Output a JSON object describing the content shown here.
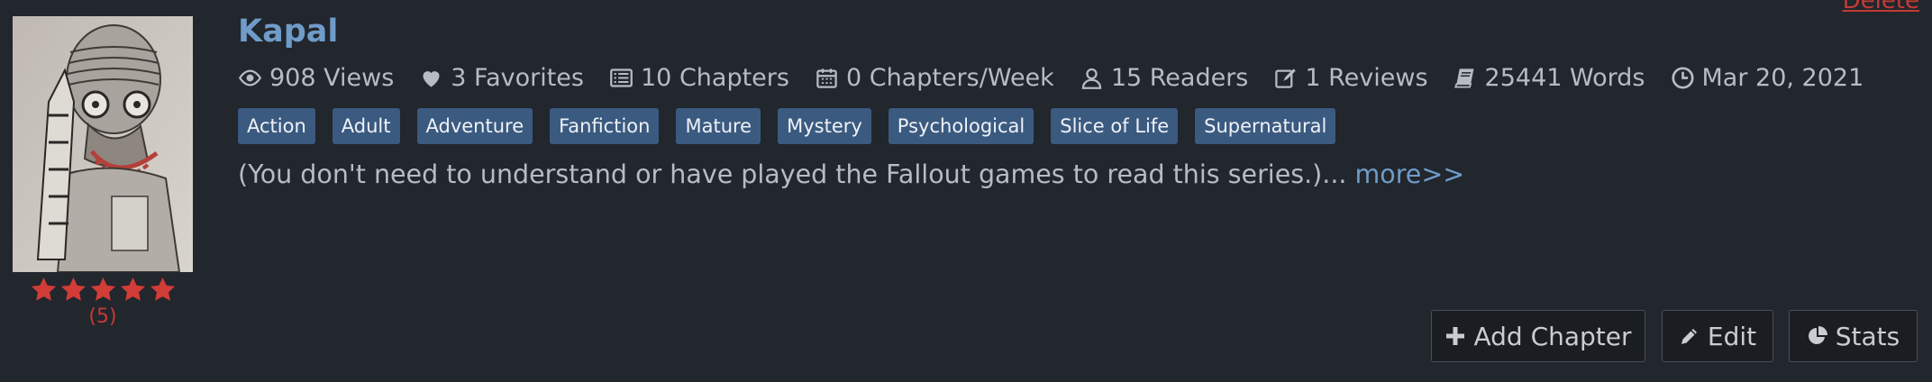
{
  "colors": {
    "background": "#22262d",
    "title": "#6f9cc9",
    "tag_background": "#3b5a80",
    "star": "#d23c36",
    "delete": "#c33a35"
  },
  "story": {
    "title": "Kapal",
    "delete_label": "Delete",
    "rating_count": "(5)",
    "rating_stars": 5,
    "stats": [
      {
        "icon": "eye-icon",
        "label": "908 Views"
      },
      {
        "icon": "heart-icon",
        "label": "3 Favorites"
      },
      {
        "icon": "list-icon",
        "label": "10 Chapters"
      },
      {
        "icon": "calendar-icon",
        "label": "0 Chapters/Week"
      },
      {
        "icon": "user-icon",
        "label": "15 Readers"
      },
      {
        "icon": "edit-icon",
        "label": "1 Reviews"
      },
      {
        "icon": "book-icon",
        "label": "25441 Words"
      },
      {
        "icon": "clock-icon",
        "label": "Mar 20, 2021"
      }
    ],
    "tags": [
      "Action",
      "Adult",
      "Adventure",
      "Fanfiction",
      "Mature",
      "Mystery",
      "Psychological",
      "Slice of Life",
      "Supernatural"
    ],
    "synopsis": "(You don't need to understand or have played the Fallout games to read this series.)...",
    "more_label": "more>>"
  },
  "actions": {
    "add_chapter": {
      "icon": "plus-icon",
      "label": "Add Chapter"
    },
    "edit": {
      "icon": "pencil-icon",
      "label": "Edit"
    },
    "stats": {
      "icon": "pie-chart-icon",
      "label": "Stats"
    }
  }
}
